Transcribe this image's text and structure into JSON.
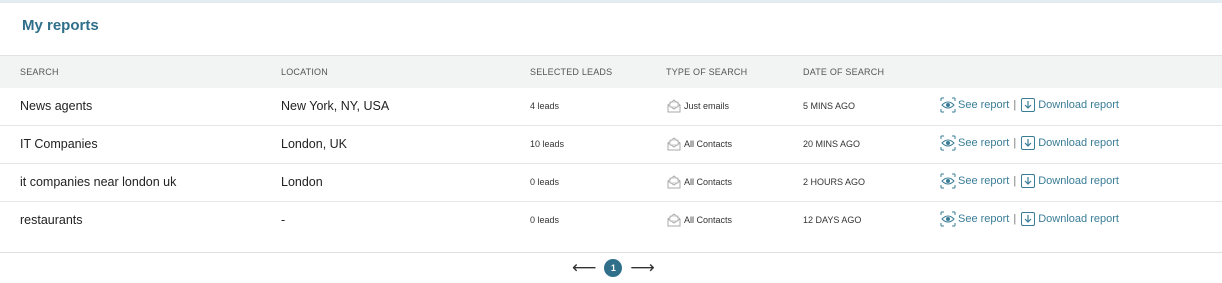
{
  "page": {
    "title": "My reports"
  },
  "table": {
    "headers": [
      "SEARCH",
      "LOCATION",
      "SELECTED LEADS",
      "TYPE OF SEARCH",
      "DATE OF SEARCH"
    ],
    "rows": [
      {
        "search": "News agents",
        "location": "New York, NY, USA",
        "leads": "4 leads",
        "type": "Just emails",
        "date": "5 MINS AGO"
      },
      {
        "search": "IT Companies",
        "location": "London, UK",
        "leads": "10 leads",
        "type": "All Contacts",
        "date": "20 MINS AGO"
      },
      {
        "search": "it companies near london uk",
        "location": "London",
        "leads": "0 leads",
        "type": "All Contacts",
        "date": "2 HOURS AGO"
      },
      {
        "search": "restaurants",
        "location": "-",
        "leads": "0 leads",
        "type": "All Contacts",
        "date": "12 DAYS AGO"
      }
    ],
    "actions": {
      "see": "See report",
      "separator": "|",
      "download": "Download report"
    }
  },
  "pagination": {
    "prev": "⟵",
    "current": "1",
    "next": "⟶"
  },
  "colors": {
    "accent": "#2f6f8a",
    "link": "#3a7d97"
  },
  "icons": {
    "type": "envelope-icon",
    "see": "eye-icon",
    "download": "download-icon"
  }
}
